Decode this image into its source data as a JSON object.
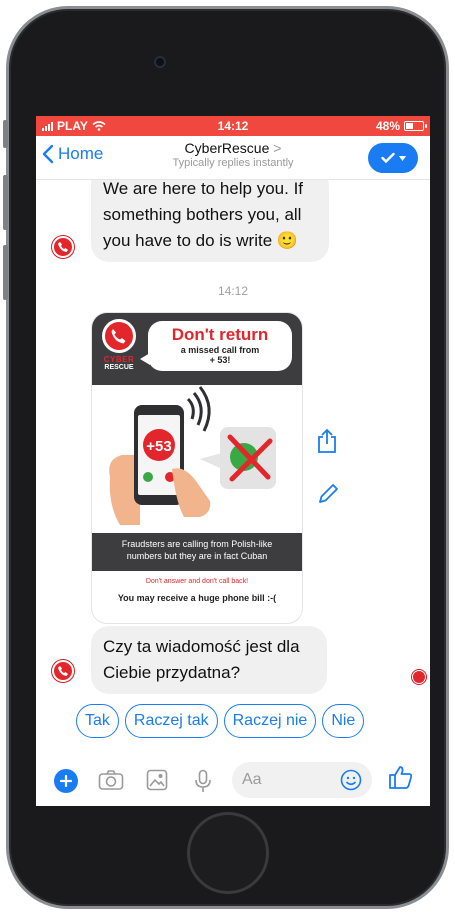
{
  "status_bar": {
    "carrier": "PLAY",
    "time": "14:12",
    "battery": "48%",
    "battery_level": 0.48,
    "color": "#f0483e"
  },
  "nav": {
    "back_label": "Home",
    "title": "CyberRescue",
    "title_chevron": ">",
    "subtitle": "Typically replies instantly",
    "accent": "#1a7cf3"
  },
  "messages": {
    "first": {
      "line1": "We are here to help you. If",
      "line2": "something bothers you, all",
      "line3": "you have to do is write 🙂"
    },
    "timestamp": "14:12",
    "card": {
      "brand_line1": "CYBER",
      "brand_line2": "RESCUE",
      "title": "Don't return",
      "subtitle_line1": "a missed call from",
      "subtitle_line2": "+ 53!",
      "phone_number": "+53",
      "banner_line1": "Fraudsters are calling from Polish-like",
      "banner_line2": "numbers but they are in fact Cuban",
      "warning": "Don't answer and don't call back!",
      "bill": "You may receive a huge phone bill :-("
    },
    "question": {
      "line1": "Czy ta wiadomość jest dla",
      "line2": "Ciebie przydatna?"
    }
  },
  "quick_replies": [
    "Tak",
    "Raczej tak",
    "Raczej nie",
    "Nie"
  ],
  "composer": {
    "placeholder": "Aa",
    "icons": [
      "plus-icon",
      "camera-icon",
      "image-icon",
      "microphone-icon",
      "emoji-icon",
      "thumbs-up-icon"
    ]
  },
  "colors": {
    "brand_red": "#e2262c",
    "bubble_gray": "#f0f0f0"
  }
}
